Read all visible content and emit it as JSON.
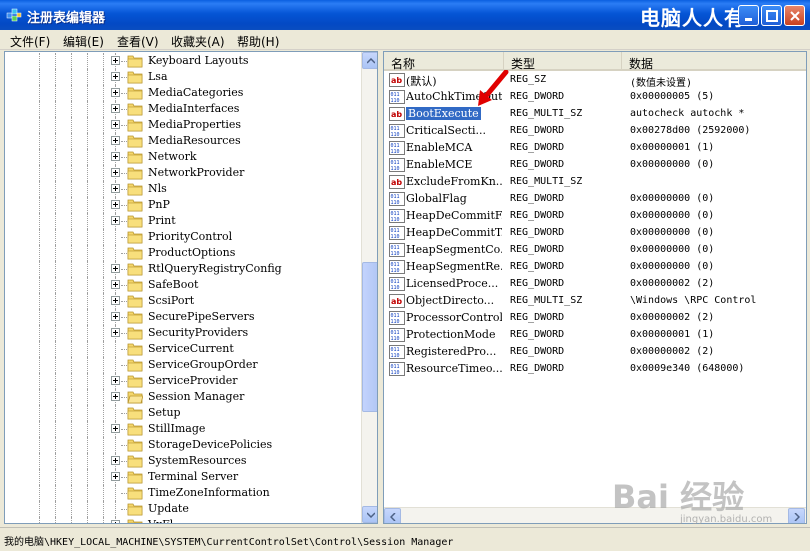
{
  "window": {
    "title": "注册表编辑器",
    "brand_text": "电脑人人有"
  },
  "menu": [
    "文件(F)",
    "编辑(E)",
    "查看(V)",
    "收藏夹(A)",
    "帮助(H)"
  ],
  "tree": {
    "items": [
      {
        "label": "Keyboard Layouts",
        "expandable": true
      },
      {
        "label": "Lsa",
        "expandable": true
      },
      {
        "label": "MediaCategories",
        "expandable": true
      },
      {
        "label": "MediaInterfaces",
        "expandable": true
      },
      {
        "label": "MediaProperties",
        "expandable": true
      },
      {
        "label": "MediaResources",
        "expandable": true
      },
      {
        "label": "Network",
        "expandable": true
      },
      {
        "label": "NetworkProvider",
        "expandable": true
      },
      {
        "label": "Nls",
        "expandable": true
      },
      {
        "label": "PnP",
        "expandable": true
      },
      {
        "label": "Print",
        "expandable": true
      },
      {
        "label": "PriorityControl",
        "expandable": false
      },
      {
        "label": "ProductOptions",
        "expandable": false
      },
      {
        "label": "RtlQueryRegistryConfig",
        "expandable": true
      },
      {
        "label": "SafeBoot",
        "expandable": true
      },
      {
        "label": "ScsiPort",
        "expandable": true
      },
      {
        "label": "SecurePipeServers",
        "expandable": true
      },
      {
        "label": "SecurityProviders",
        "expandable": true
      },
      {
        "label": "ServiceCurrent",
        "expandable": false
      },
      {
        "label": "ServiceGroupOrder",
        "expandable": false
      },
      {
        "label": "ServiceProvider",
        "expandable": true
      },
      {
        "label": "Session Manager",
        "expandable": true,
        "selected": true
      },
      {
        "label": "Setup",
        "expandable": false
      },
      {
        "label": "StillImage",
        "expandable": true
      },
      {
        "label": "StorageDevicePolicies",
        "expandable": false
      },
      {
        "label": "SystemResources",
        "expandable": true
      },
      {
        "label": "Terminal Server",
        "expandable": true
      },
      {
        "label": "TimeZoneInformation",
        "expandable": false
      },
      {
        "label": "Update",
        "expandable": false
      },
      {
        "label": "VxFl",
        "expandable": true
      }
    ]
  },
  "list": {
    "columns": [
      "名称",
      "类型",
      "数据"
    ],
    "rows": [
      {
        "name": "(默认)",
        "type": "REG_SZ",
        "data": "(数值未设置)",
        "icon": "string-value-icon"
      },
      {
        "name": "AutoChkTimeOut",
        "type": "REG_DWORD",
        "data": "0x00000005 (5)",
        "icon": "binary-value-icon"
      },
      {
        "name": "BootExecute",
        "type": "REG_MULTI_SZ",
        "data": "autocheck autochk *",
        "icon": "string-value-icon",
        "selected": true
      },
      {
        "name": "CriticalSecti...",
        "type": "REG_DWORD",
        "data": "0x00278d00 (2592000)",
        "icon": "binary-value-icon"
      },
      {
        "name": "EnableMCA",
        "type": "REG_DWORD",
        "data": "0x00000001 (1)",
        "icon": "binary-value-icon"
      },
      {
        "name": "EnableMCE",
        "type": "REG_DWORD",
        "data": "0x00000000 (0)",
        "icon": "binary-value-icon"
      },
      {
        "name": "ExcludeFromKn...",
        "type": "REG_MULTI_SZ",
        "data": "",
        "icon": "string-value-icon"
      },
      {
        "name": "GlobalFlag",
        "type": "REG_DWORD",
        "data": "0x00000000 (0)",
        "icon": "binary-value-icon"
      },
      {
        "name": "HeapDeCommitF...",
        "type": "REG_DWORD",
        "data": "0x00000000 (0)",
        "icon": "binary-value-icon"
      },
      {
        "name": "HeapDeCommitT...",
        "type": "REG_DWORD",
        "data": "0x00000000 (0)",
        "icon": "binary-value-icon"
      },
      {
        "name": "HeapSegmentCo...",
        "type": "REG_DWORD",
        "data": "0x00000000 (0)",
        "icon": "binary-value-icon"
      },
      {
        "name": "HeapSegmentRe...",
        "type": "REG_DWORD",
        "data": "0x00000000 (0)",
        "icon": "binary-value-icon"
      },
      {
        "name": "LicensedProce...",
        "type": "REG_DWORD",
        "data": "0x00000002 (2)",
        "icon": "binary-value-icon"
      },
      {
        "name": "ObjectDirecto...",
        "type": "REG_MULTI_SZ",
        "data": "\\Windows \\RPC Control",
        "icon": "string-value-icon"
      },
      {
        "name": "ProcessorControl",
        "type": "REG_DWORD",
        "data": "0x00000002 (2)",
        "icon": "binary-value-icon"
      },
      {
        "name": "ProtectionMode",
        "type": "REG_DWORD",
        "data": "0x00000001 (1)",
        "icon": "binary-value-icon"
      },
      {
        "name": "RegisteredPro...",
        "type": "REG_DWORD",
        "data": "0x00000002 (2)",
        "icon": "binary-value-icon"
      },
      {
        "name": "ResourceTimeo...",
        "type": "REG_DWORD",
        "data": "0x0009e340 (648000)",
        "icon": "binary-value-icon"
      }
    ]
  },
  "status": {
    "path": "我的电脑\\HKEY_LOCAL_MACHINE\\SYSTEM\\CurrentControlSet\\Control\\Session Manager"
  },
  "watermark": {
    "text": "Bai 经验",
    "sub": "jingyan.baidu.com"
  },
  "colors": {
    "titlebar": "#0555d6",
    "selection": "#316ac5",
    "arrow": "#e00000"
  }
}
